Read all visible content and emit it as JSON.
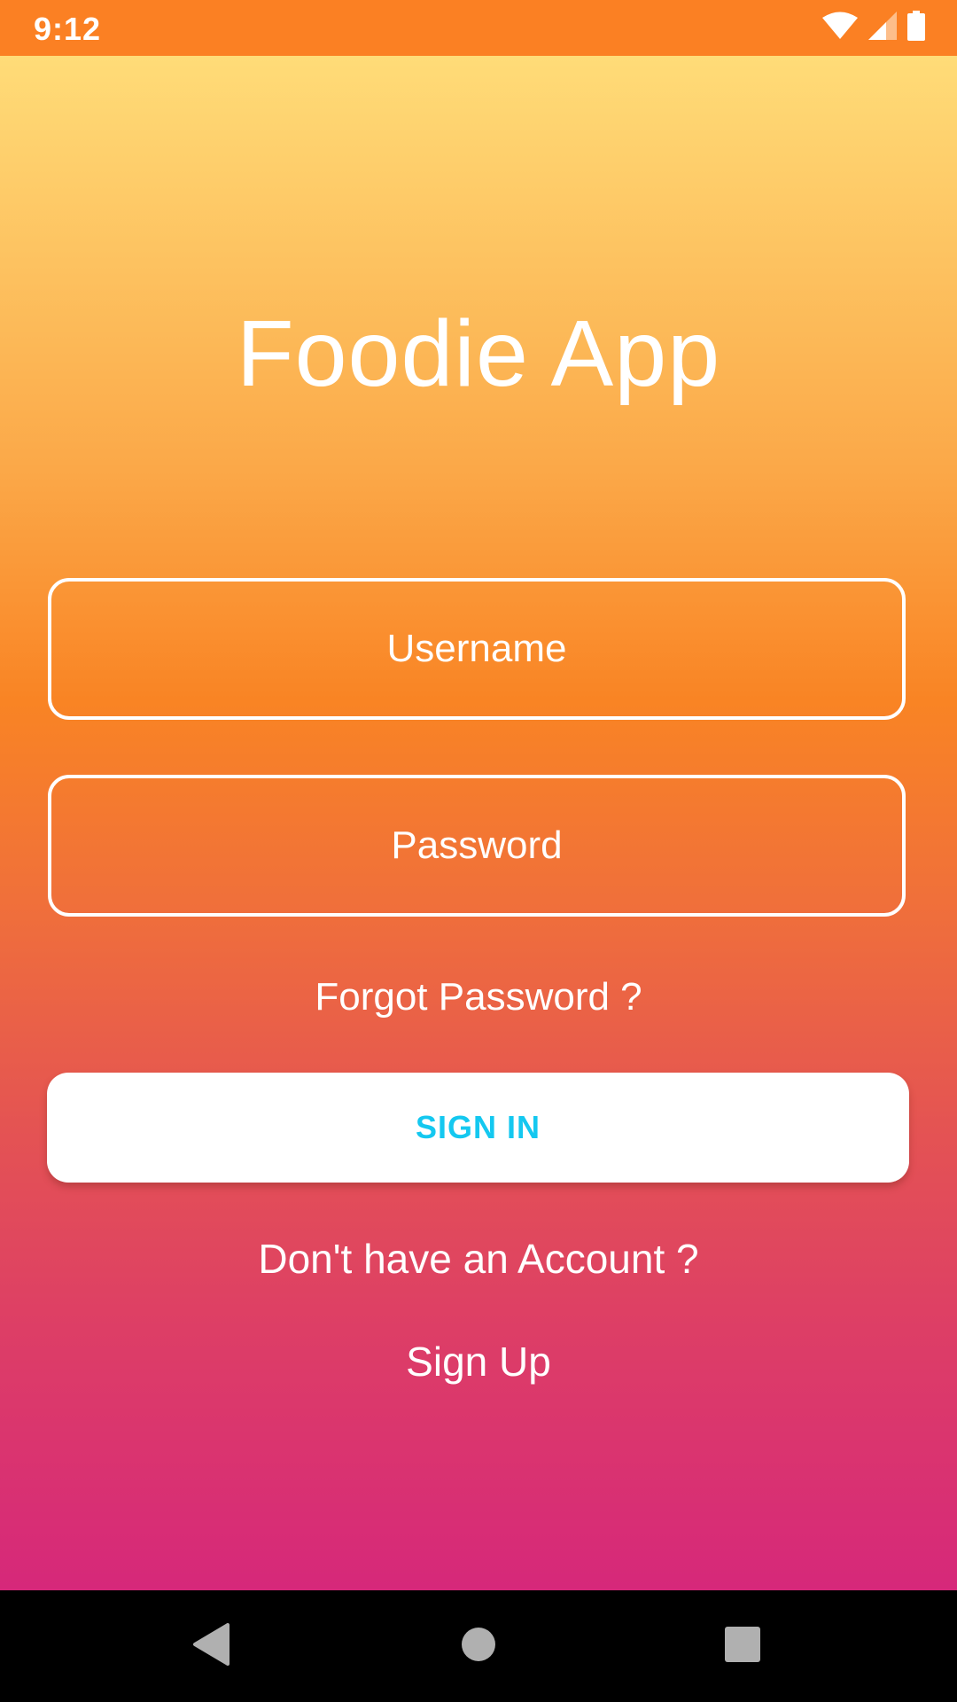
{
  "status_bar": {
    "time": "9:12",
    "background": "#FB8023",
    "icons": [
      "wifi-icon",
      "cellular-signal-icon",
      "battery-icon"
    ]
  },
  "app": {
    "title": "Foodie App"
  },
  "form": {
    "username_placeholder": "Username",
    "username_value": "",
    "password_placeholder": "Password",
    "password_value": "",
    "forgot_password": "Forgot Password ?",
    "sign_in_label": "SIGN IN",
    "no_account_text": "Don't have an Account ?",
    "sign_up_label": "Sign Up"
  },
  "colors": {
    "gradient_top": "#FFDC78",
    "gradient_middle": "#F98424",
    "gradient_bottom": "#D6287A",
    "sign_in_text": "#14C8F0",
    "text": "#FFFFFF"
  },
  "nav_bar": {
    "icons": [
      "back-icon",
      "home-icon",
      "recents-icon"
    ]
  }
}
